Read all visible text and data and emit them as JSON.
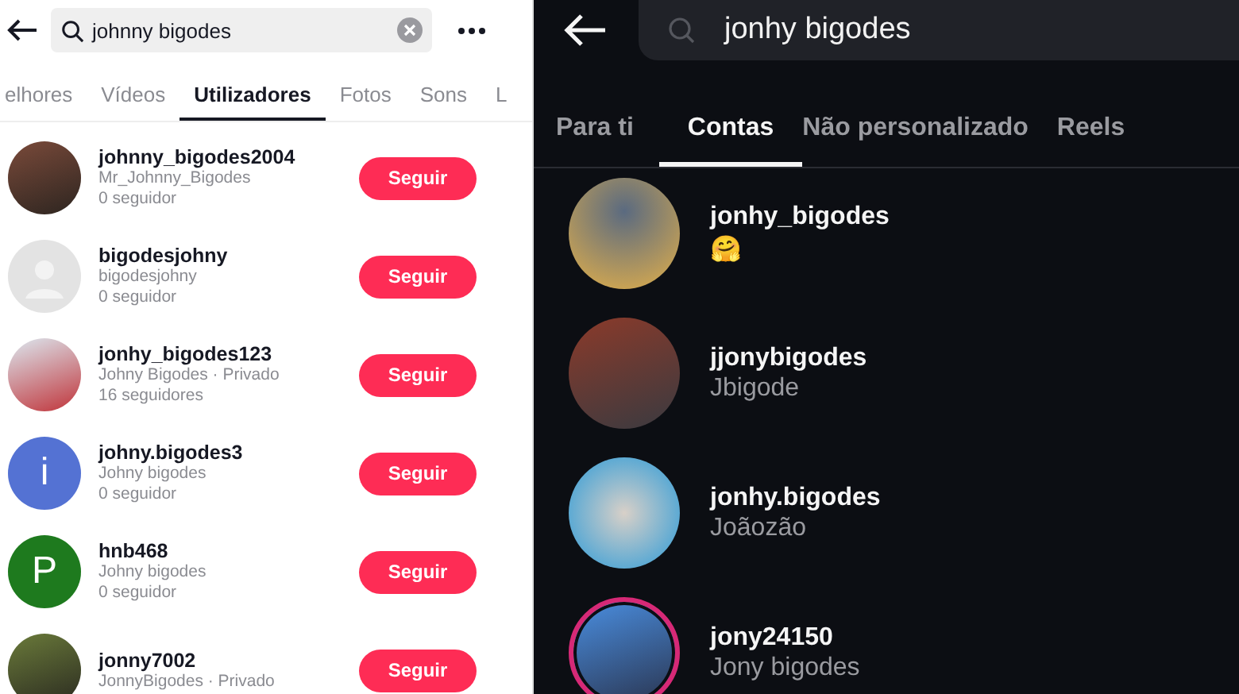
{
  "left": {
    "search": {
      "value": "johnny bigodes"
    },
    "tabs": [
      {
        "label": "elhores",
        "selected": false
      },
      {
        "label": "Vídeos",
        "selected": false
      },
      {
        "label": "Utilizadores",
        "selected": true
      },
      {
        "label": "Fotos",
        "selected": false
      },
      {
        "label": "Sons",
        "selected": false
      },
      {
        "label": "L",
        "selected": false
      }
    ],
    "users": [
      {
        "username": "johnny_bigodes2004",
        "subtitle": "Mr_Johnny_Bigodes",
        "followers": "0 seguidor",
        "avatar": {
          "kind": "photo"
        },
        "button": "Seguir"
      },
      {
        "username": "bigodesjohny",
        "subtitle": "bigodesjohny",
        "followers": "0 seguidor",
        "avatar": {
          "kind": "default"
        },
        "button": "Seguir"
      },
      {
        "username": "jonhy_bigodes123",
        "subtitle": "Johny Bigodes · Privado",
        "followers": "16 seguidores",
        "avatar": {
          "kind": "photo"
        },
        "button": "Seguir"
      },
      {
        "username": "johny.bigodes3",
        "subtitle": "Johny bigodes",
        "followers": "0 seguidor",
        "avatar": {
          "kind": "letter",
          "letter": "i",
          "color": "#5472d3"
        },
        "button": "Seguir"
      },
      {
        "username": "hnb468",
        "subtitle": "Johny bigodes",
        "followers": "0 seguidor",
        "avatar": {
          "kind": "letter",
          "letter": "P",
          "color": "#1e7a1e"
        },
        "button": "Seguir"
      },
      {
        "username": "jonny7002",
        "subtitle": "JonnyBigodes · Privado",
        "avatar": {
          "kind": "photo"
        },
        "button": "Seguir"
      }
    ]
  },
  "right": {
    "search": {
      "value": "jonhy bigodes"
    },
    "tabs": [
      {
        "label": "Para ti",
        "selected": false
      },
      {
        "label": "Contas",
        "selected": true
      },
      {
        "label": "Não personalizado",
        "selected": false
      },
      {
        "label": "Reels",
        "selected": false
      }
    ],
    "accounts": [
      {
        "username": "jonhy_bigodes",
        "subtitle": "🤗",
        "story": false
      },
      {
        "username": "jjonybigodes",
        "subtitle": "Jbigode",
        "story": false
      },
      {
        "username": "jonhy.bigodes",
        "subtitle": "Joãozão",
        "story": false
      },
      {
        "username": "jony24150",
        "subtitle": "Jony bigodes",
        "story": true
      }
    ]
  }
}
